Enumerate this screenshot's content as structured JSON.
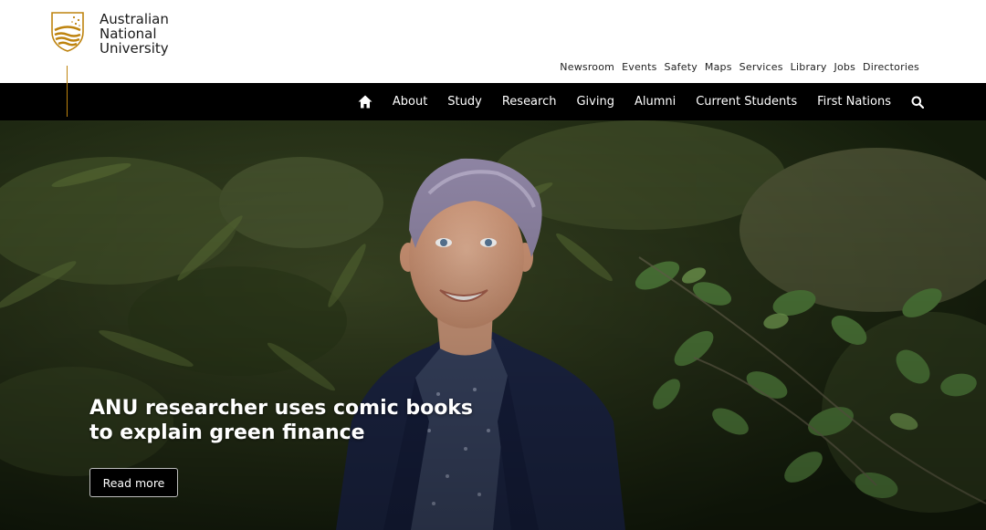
{
  "brand": {
    "name_line1": "Australian",
    "name_line2": "National",
    "name_line3": "University",
    "gold": "#be830e"
  },
  "utility_nav": [
    {
      "label": "Newsroom"
    },
    {
      "label": "Events"
    },
    {
      "label": "Safety"
    },
    {
      "label": "Maps"
    },
    {
      "label": "Services"
    },
    {
      "label": "Library"
    },
    {
      "label": "Jobs"
    },
    {
      "label": "Directories"
    }
  ],
  "main_nav": {
    "home_icon": "home-icon",
    "items": [
      {
        "label": "About"
      },
      {
        "label": "Study"
      },
      {
        "label": "Research"
      },
      {
        "label": "Giving"
      },
      {
        "label": "Alumni"
      },
      {
        "label": "Current Students"
      },
      {
        "label": "First Nations"
      }
    ],
    "search_icon": "search-icon"
  },
  "hero": {
    "headline": "ANU researcher uses comic books to explain green finance",
    "cta_label": "Read more"
  }
}
